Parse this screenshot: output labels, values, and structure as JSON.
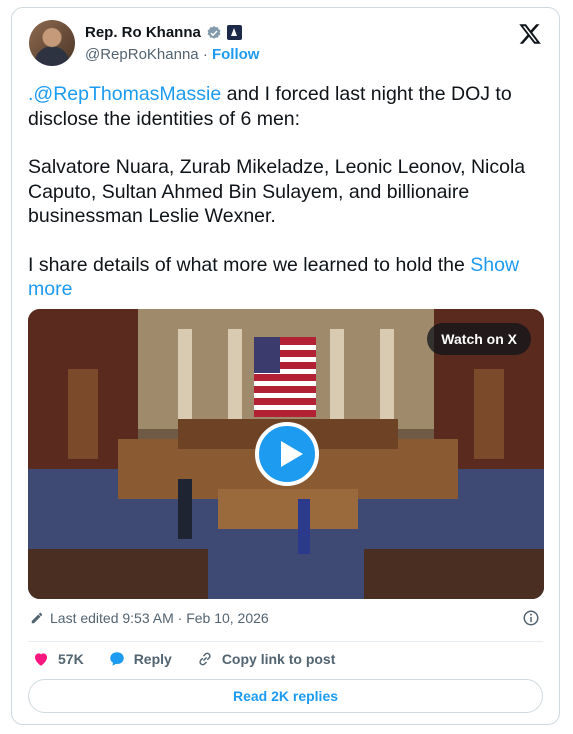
{
  "author": {
    "name": "Rep. Ro Khanna",
    "handle": "@RepRoKhanna",
    "separator": "·",
    "follow_label": "Follow"
  },
  "icons": {
    "verified": "verified-badge-icon",
    "government": "government-badge-icon",
    "platform": "x-logo-icon",
    "edit": "pencil-icon",
    "info": "info-icon",
    "like": "heart-icon",
    "reply": "speech-bubble-icon",
    "copy": "link-icon",
    "play": "play-icon"
  },
  "colors": {
    "accent": "#1d9bf0",
    "like": "#f91880",
    "text": "#0f1419",
    "muted": "#536471"
  },
  "tweet": {
    "mention": ".@RepThomasMassie",
    "line1_rest": " and I forced last night the DOJ to disclose the identities of 6 men:",
    "paragraph2": "Salvatore Nuara, Zurab Mikeladze, Leonic Leonov, Nicola Caputo, Sultan Ahmed Bin Sulayem, and billionaire businessman Leslie Wexner.",
    "paragraph3": "I share details of what more we learned to hold the ",
    "show_more": "Show more"
  },
  "media": {
    "watch_label": "Watch on X"
  },
  "meta": {
    "edited_label": "Last edited 9:53 AM · Feb 10, 2026"
  },
  "actions": {
    "likes": "57K",
    "reply_label": "Reply",
    "copy_label": "Copy link to post",
    "read_replies_label": "Read 2K replies"
  }
}
